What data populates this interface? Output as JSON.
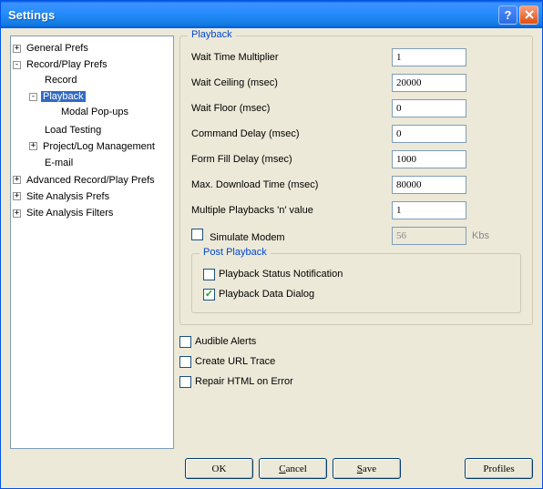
{
  "window": {
    "title": "Settings"
  },
  "tree": {
    "general": "General Prefs",
    "recordplay": "Record/Play Prefs",
    "record": "Record",
    "playback": "Playback",
    "modal": "Modal Pop-ups",
    "loadtest": "Load Testing",
    "projlog": "Project/Log Management",
    "email": "E-mail",
    "advanced": "Advanced Record/Play Prefs",
    "siteprefs": "Site Analysis Prefs",
    "sitefilters": "Site Analysis Filters"
  },
  "playback": {
    "group_title": "Playback",
    "wait_mult_label": "Wait Time Multiplier",
    "wait_mult_value": "1",
    "wait_ceil_label": "Wait Ceiling (msec)",
    "wait_ceil_value": "20000",
    "wait_floor_label": "Wait Floor (msec)",
    "wait_floor_value": "0",
    "cmd_delay_label": "Command Delay (msec)",
    "cmd_delay_value": "0",
    "form_fill_label": "Form Fill Delay (msec)",
    "form_fill_value": "1000",
    "max_dl_label": "Max. Download Time (msec)",
    "max_dl_value": "80000",
    "multi_play_label": "Multiple Playbacks 'n' value",
    "multi_play_value": "1",
    "sim_modem_label": "Simulate Modem",
    "sim_modem_value": "56",
    "sim_modem_unit": "Kbs",
    "post_title": "Post Playback",
    "post_status_label": "Playback Status Notification",
    "post_data_label": "Playback Data Dialog",
    "audible_label": "Audible Alerts",
    "url_trace_label": "Create URL Trace",
    "repair_label": "Repair HTML on Error"
  },
  "buttons": {
    "ok": "OK",
    "cancel": "Cancel",
    "save": "Save",
    "profiles": "Profiles"
  }
}
